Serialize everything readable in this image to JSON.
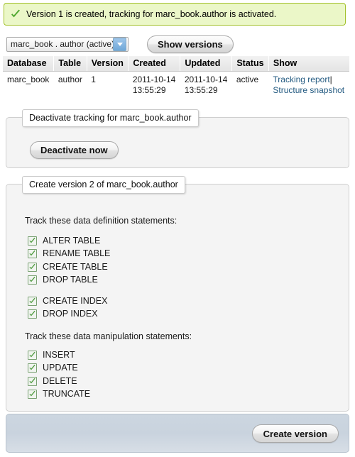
{
  "notice": {
    "icon": "success-check-icon",
    "message": "Version 1 is created, tracking for marc_book.author is activated.",
    "background_color": "#ebf7c8",
    "border_color": "#a2c12a"
  },
  "toolbar": {
    "version_select": {
      "selected": "marc_book . author (active)",
      "options": [
        "marc_book . author (active)"
      ],
      "arrow_icon": "chevron-down-icon",
      "arrow_color": "#6fa8d8"
    },
    "show_versions_label": "Show versions"
  },
  "table": {
    "columns": [
      "Database",
      "Table",
      "Version",
      "Created",
      "Updated",
      "Status",
      "Show"
    ],
    "rows": [
      {
        "database": "marc_book",
        "table": "author",
        "version": "1",
        "created_date": "2011-10-14",
        "created_time": "13:55:29",
        "updated_date": "2011-10-14",
        "updated_time": "13:55:29",
        "status": "active",
        "link_tracking_report": "Tracking report",
        "link_separator": "|",
        "link_structure_snapshot": "Structure snapshot"
      }
    ],
    "link_color": "#235a81"
  },
  "deactivate_panel": {
    "legend": "Deactivate tracking for marc_book.author",
    "button_label": "Deactivate now"
  },
  "create_panel": {
    "legend": "Create version 2 of marc_book.author",
    "ddl_label": "Track these data definition statements:",
    "ddl_group1": [
      {
        "label": "ALTER TABLE",
        "checked": true
      },
      {
        "label": "RENAME TABLE",
        "checked": true
      },
      {
        "label": "CREATE TABLE",
        "checked": true
      },
      {
        "label": "DROP TABLE",
        "checked": true
      }
    ],
    "ddl_group2": [
      {
        "label": "CREATE INDEX",
        "checked": true
      },
      {
        "label": "DROP INDEX",
        "checked": true
      }
    ],
    "dml_label": "Track these data manipulation statements:",
    "dml_group": [
      {
        "label": "INSERT",
        "checked": true
      },
      {
        "label": "UPDATE",
        "checked": true
      },
      {
        "label": "DELETE",
        "checked": true
      },
      {
        "label": "TRUNCATE",
        "checked": true
      }
    ],
    "checkbox_border_color": "#7aa173",
    "checkmark_color": "#4e9a3e"
  },
  "footer": {
    "create_version_label": "Create version",
    "background_color": "#ccd6e0"
  }
}
